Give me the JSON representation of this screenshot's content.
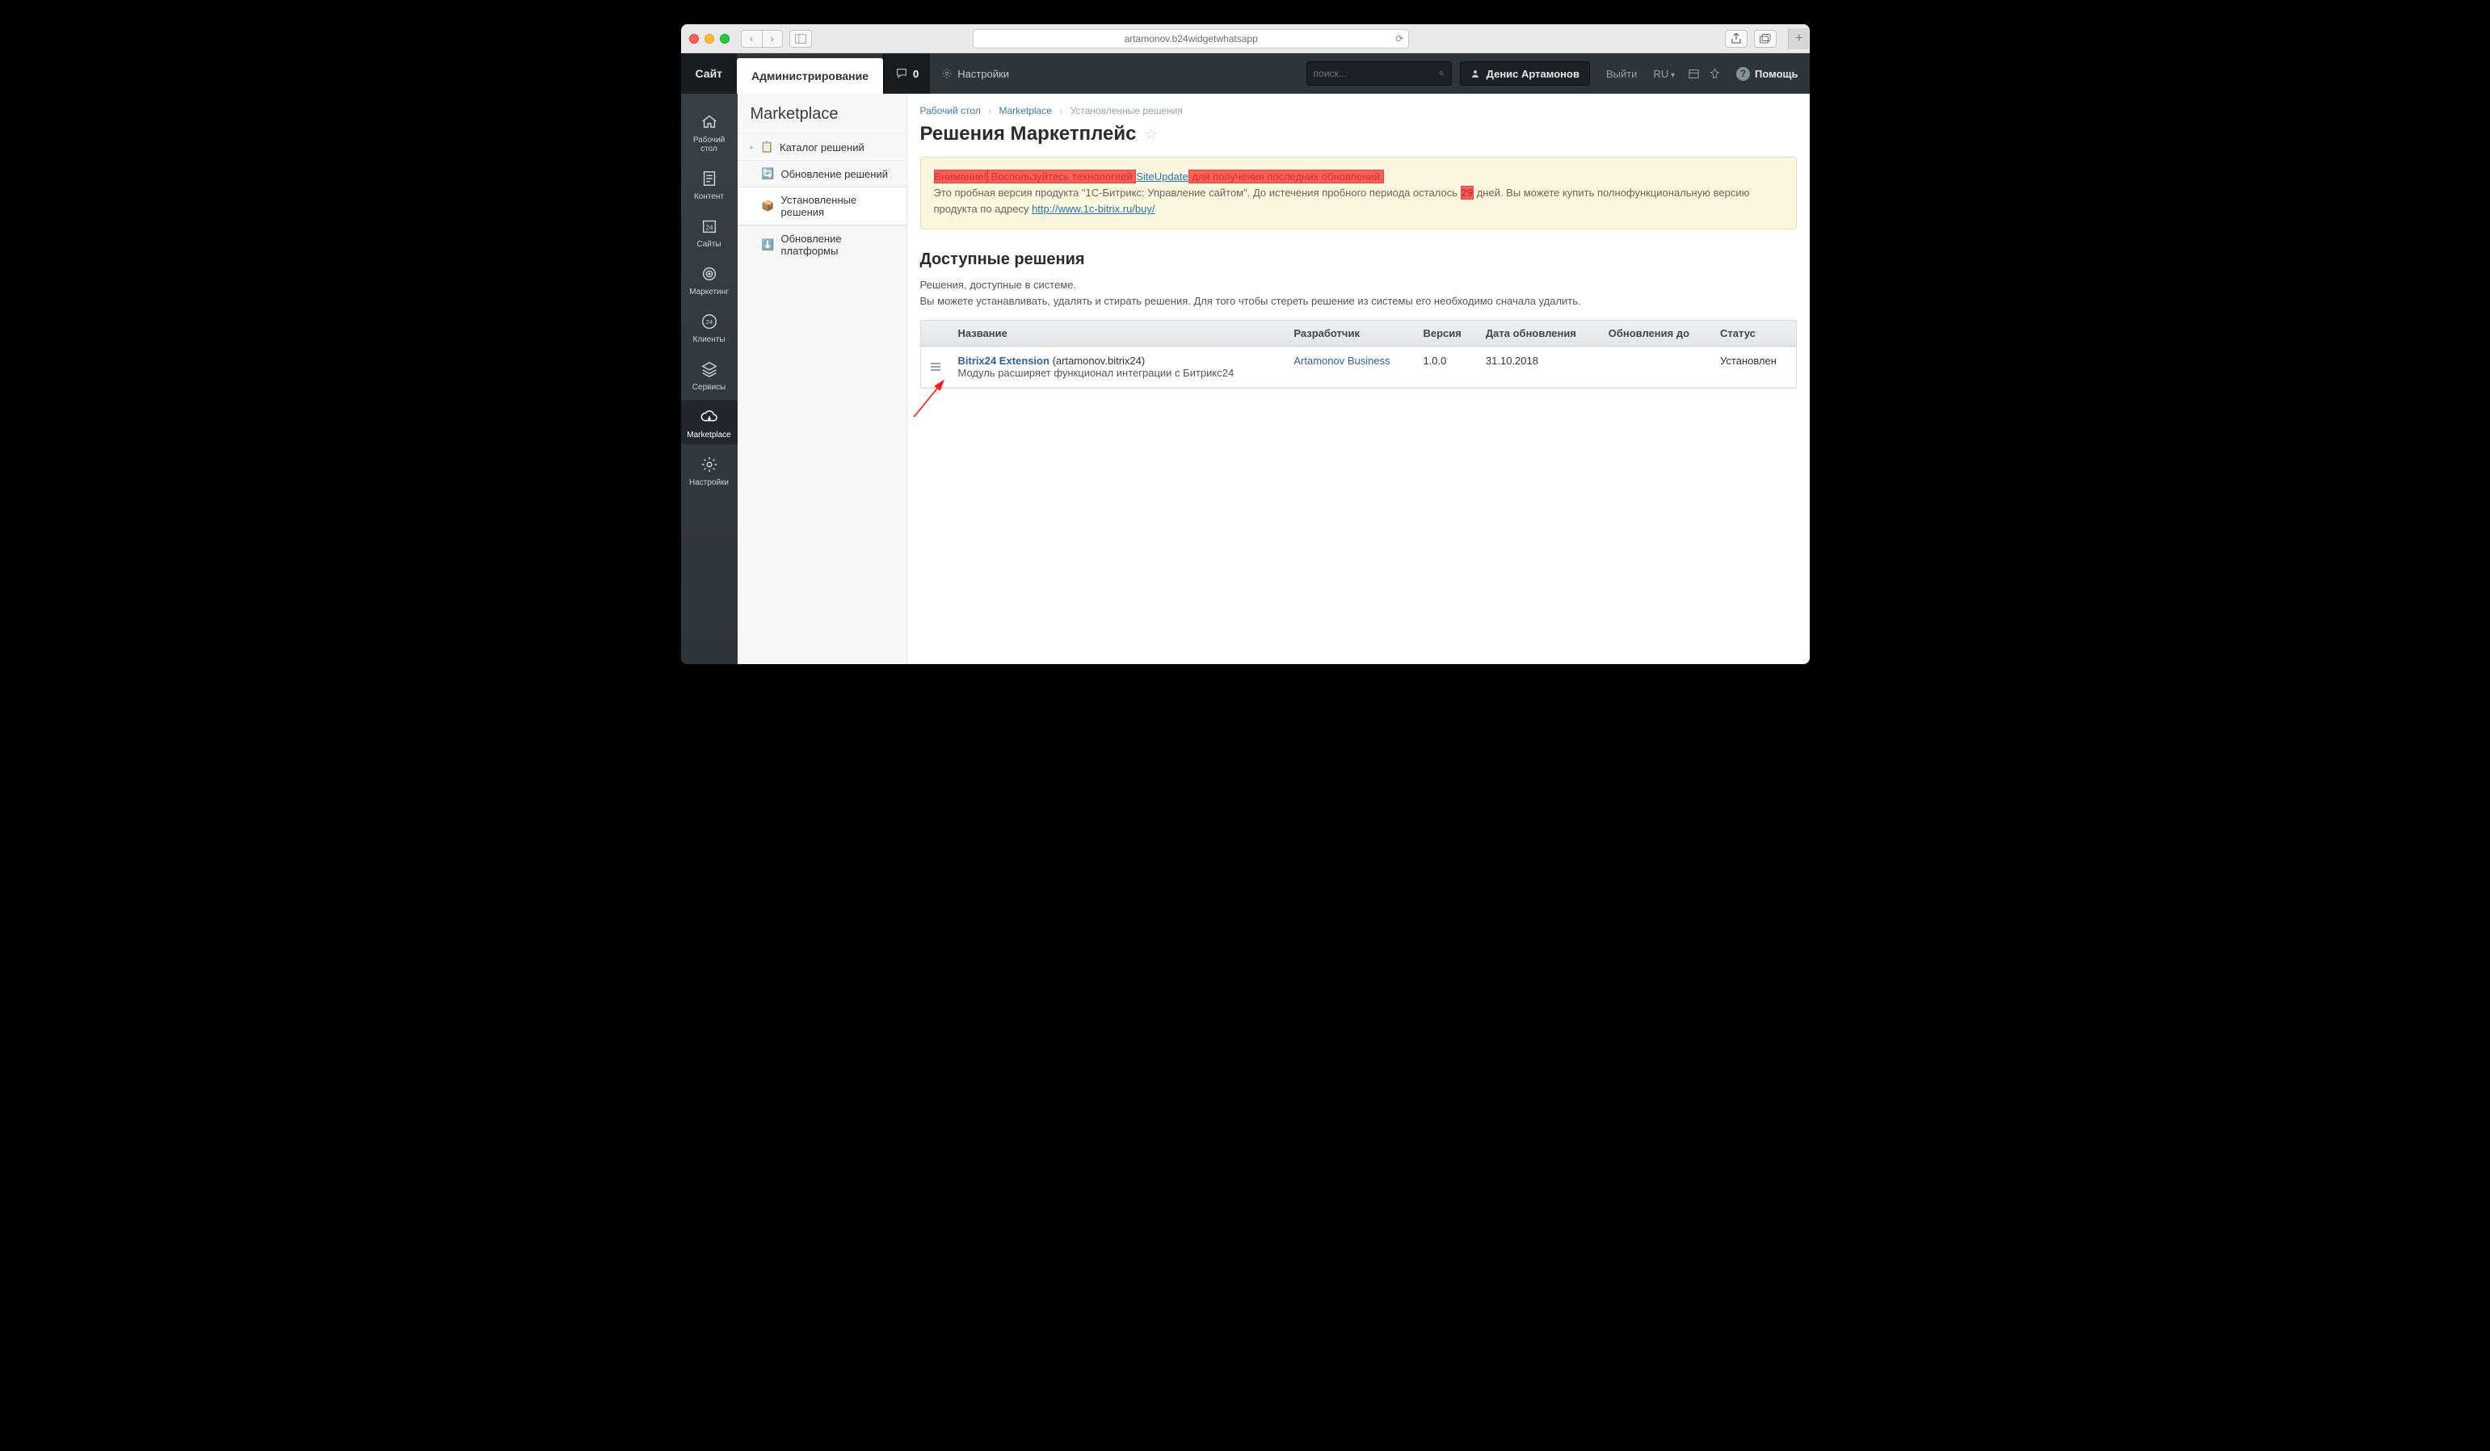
{
  "chrome": {
    "url": "artamonov.b24widgetwhatsapp"
  },
  "topbar": {
    "tabs": {
      "site": "Сайт",
      "admin": "Администрирование"
    },
    "notif_count": "0",
    "settings": "Настройки",
    "search_placeholder": "поиск...",
    "user_name": "Денис Артамонов",
    "logout": "Выйти",
    "lang": "RU",
    "help": "Помощь"
  },
  "rail": {
    "desktop": "Рабочий\nстол",
    "content": "Контент",
    "sites": "Сайты",
    "marketing": "Маркетинг",
    "clients": "Клиенты",
    "services": "Сервисы",
    "marketplace": "Marketplace",
    "settings": "Настройки"
  },
  "sidebar": {
    "title": "Marketplace",
    "items": {
      "catalog": "Каталог решений",
      "updates": "Обновление решений",
      "installed": "Установленные решения",
      "platform": "Обновление платформы"
    }
  },
  "breadcrumb": {
    "desktop": "Рабочий стол",
    "marketplace": "Marketplace",
    "installed": "Установленные решения"
  },
  "page": {
    "title": "Решения Маркетплейс"
  },
  "warning": {
    "attention": "Внимание!",
    "use_tech": " Воспользуйтесь технологией ",
    "siteupdate": "SiteUpdate",
    "for_updates": " для получения последних обновлений.",
    "trial1": "Это пробная версия продукта \"1С-Битрикс: Управление сайтом\". До истечения пробного периода осталось ",
    "days": "29",
    "trial2": " дней. Вы можете купить полнофункциональную версию продукта по адресу ",
    "buy_link": "http://www.1c-bitrix.ru/buy/"
  },
  "section": {
    "title": "Доступные решения",
    "desc1": "Решения, доступные в системе.",
    "desc2": "Вы можете устанавливать, удалять и стирать решения. Для того чтобы стереть решение из системы его необходимо сначала удалить."
  },
  "table": {
    "headers": {
      "name": "Название",
      "dev": "Разработчик",
      "version": "Версия",
      "updated": "Дата обновления",
      "until": "Обновления до",
      "status": "Статус"
    },
    "row": {
      "name_link": "Bitrix24 Extension",
      "name_code": "(artamonov.bitrix24)",
      "desc": "Модуль расширяет функционал интеграции с Битрикс24",
      "dev": "Artamonov Business",
      "version": "1.0.0",
      "updated": "31.10.2018",
      "until": "",
      "status": "Установлен"
    }
  }
}
